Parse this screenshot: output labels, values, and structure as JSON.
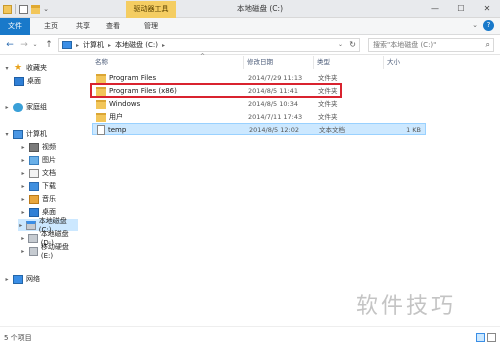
{
  "titlebar": {
    "context_tab": "驱动器工具",
    "title": "本地磁盘 (C:)",
    "minimize": "—",
    "maximize": "☐",
    "close": "✕"
  },
  "ribbon": {
    "tabs": [
      "文件",
      "主页",
      "共享",
      "查看",
      "管理"
    ],
    "expand": "⌄",
    "help": "?"
  },
  "address": {
    "back": "←",
    "forward": "→",
    "dropdown": "⌄",
    "up": "↑",
    "crumbs": [
      "计算机",
      "本地磁盘 (C:)"
    ],
    "sep": "▸",
    "path_dropdown": "⌄",
    "refresh": "↻",
    "search_placeholder": "搜索\"本地磁盘 (C:)\"",
    "search_icon": "⌕"
  },
  "navpane": {
    "favorites": "收藏夹",
    "desktop": "桌面",
    "homegroup": "家庭组",
    "computer": "计算机",
    "items": [
      "视频",
      "图片",
      "文档",
      "下载",
      "音乐",
      "桌面"
    ],
    "drives": [
      "本地磁盘 (C:)",
      "本地磁盘 (D:)",
      "移动硬盘 (E:)"
    ],
    "network": "网络",
    "chevron_open": "▾",
    "chevron_closed": "▸",
    "star": "★"
  },
  "columns": {
    "name": "名称",
    "date": "修改日期",
    "type": "类型",
    "size": "大小",
    "sort": "^"
  },
  "files": [
    {
      "name": "Program Files",
      "date": "2014/7/29 11:13",
      "type": "文件夹",
      "size": ""
    },
    {
      "name": "Program Files (x86)",
      "date": "2014/8/5 11:41",
      "type": "文件夹",
      "size": ""
    },
    {
      "name": "Windows",
      "date": "2014/8/5 10:34",
      "type": "文件夹",
      "size": ""
    },
    {
      "name": "用户",
      "date": "2014/7/11 17:43",
      "type": "文件夹",
      "size": ""
    },
    {
      "name": "temp",
      "date": "2014/8/5 12:02",
      "type": "文本文档",
      "size": "1 KB"
    }
  ],
  "status": {
    "count": "5 个项目"
  },
  "watermark": "软件技巧",
  "colors": {
    "file_tab": "#1979ca",
    "context_tab": "#f4cd62",
    "selection": "#cce8ff",
    "highlight_box": "#d9232f"
  }
}
